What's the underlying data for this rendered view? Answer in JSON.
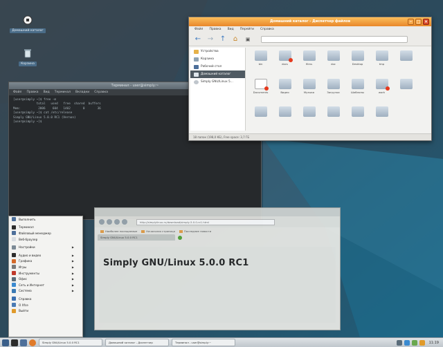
{
  "desktop": {
    "icons": [
      {
        "label": "Домашний каталог"
      },
      {
        "label": "Корзина"
      }
    ]
  },
  "terminal": {
    "title": "Терминал - user@simply:~",
    "menu": [
      "Файл",
      "Правка",
      "Вид",
      "Терминал",
      "Вкладки",
      "Справка"
    ],
    "lines": [
      "[user@simply ~]$ free -m",
      "             total   used   free  shared  buffers",
      "Mem:          2006    604   1402       0       36",
      "[user@simply ~]$ cat /etc/release",
      "Simply GNU/Linux 5.0.0 RC1 (Vernon)",
      "[user@simply ~]$ "
    ]
  },
  "filemanager": {
    "title": "Домашний каталог - Диспетчер файлов",
    "menu": [
      "Файл",
      "Правка",
      "Вид",
      "Перейти",
      "Справка"
    ],
    "sidebar": [
      {
        "label": "Устройства"
      },
      {
        "label": "Корзина"
      },
      {
        "label": "Рабочий стол"
      },
      {
        "label": "Домашний каталог"
      },
      {
        "label": "Simply GNU/Linux 5..."
      }
    ],
    "files": [
      {
        "name": "bin",
        "badge": false,
        "doc": false
      },
      {
        "name": "docs",
        "badge": true,
        "doc": false
      },
      {
        "name": "films",
        "badge": false,
        "doc": false
      },
      {
        "name": "doc",
        "badge": false,
        "doc": false
      },
      {
        "name": "Desktop",
        "badge": false,
        "doc": false
      },
      {
        "name": "tmp",
        "badge": false,
        "doc": false
      },
      {
        "name": "",
        "badge": false,
        "doc": false
      },
      {
        "name": "Documents",
        "badge": true,
        "doc": true
      },
      {
        "name": "Видео",
        "badge": false,
        "doc": false
      },
      {
        "name": "Музыка",
        "badge": false,
        "doc": false
      },
      {
        "name": "Загрузки",
        "badge": false,
        "doc": false
      },
      {
        "name": "Шаблоны",
        "badge": false,
        "doc": false
      },
      {
        "name": "work",
        "badge": true,
        "doc": false
      },
      {
        "name": "",
        "badge": false,
        "doc": false
      },
      {
        "name": "",
        "badge": false,
        "doc": false
      },
      {
        "name": "",
        "badge": false,
        "doc": false
      },
      {
        "name": "",
        "badge": false,
        "doc": false
      },
      {
        "name": "",
        "badge": false,
        "doc": false
      },
      {
        "name": "",
        "badge": false,
        "doc": false
      },
      {
        "name": "",
        "badge": false,
        "doc": false
      }
    ],
    "status": "18 папок (198,0 КБ), Free space: 3,7 ГБ"
  },
  "browser": {
    "url": "http://simplylinux.ru/download/simply-5.0.0-rc1.html",
    "bookmarks": [
      "Наиболее посещаемые",
      "Начальная страница",
      "Последние новости"
    ],
    "tab": "Simply GNU/Linux 5.0.0 RC1",
    "headline": "Simply GNU/Linux 5.0.0 RC1"
  },
  "startmenu": {
    "items": [
      {
        "label": "Выполнить",
        "color": "#4d6f9a",
        "arrow": false
      },
      {
        "sep": true
      },
      {
        "label": "Терминал",
        "color": "#2c2c2c",
        "arrow": false
      },
      {
        "label": "Файловый менеджер",
        "color": "#4d6f9a",
        "arrow": false
      },
      {
        "label": "Веб-браузер",
        "color": "#d7dbe0",
        "arrow": false
      },
      {
        "sep": true
      },
      {
        "label": "Настройки",
        "color": "#7c8a96",
        "arrow": true
      },
      {
        "sep": true
      },
      {
        "label": "Аудио и видео",
        "color": "#2c2c2c",
        "arrow": true
      },
      {
        "label": "Графика",
        "color": "#d46a2a",
        "arrow": true
      },
      {
        "label": "Игры",
        "color": "#7a7a7a",
        "arrow": true
      },
      {
        "label": "Инструменты",
        "color": "#c0392b",
        "arrow": true
      },
      {
        "label": "Офис",
        "color": "#5a6c7a",
        "arrow": true
      },
      {
        "label": "Сеть и Интернет",
        "color": "#3a8ad0",
        "arrow": true
      },
      {
        "label": "Система",
        "color": "#3a7ab4",
        "arrow": true
      },
      {
        "sep": true
      },
      {
        "label": "Справка",
        "color": "#3a6fb0",
        "arrow": false
      },
      {
        "label": "О Xfce",
        "color": "#4a7bb4",
        "arrow": false
      },
      {
        "label": "Выйти",
        "color": "#e09a2a",
        "arrow": false
      }
    ]
  },
  "taskbar": {
    "tasks": [
      "Simply GNU/Linux 5.0.0 RC1",
      "Домашний каталог - Диспетчер",
      "Терминал - user@simply:~"
    ],
    "clock": "11:19"
  }
}
